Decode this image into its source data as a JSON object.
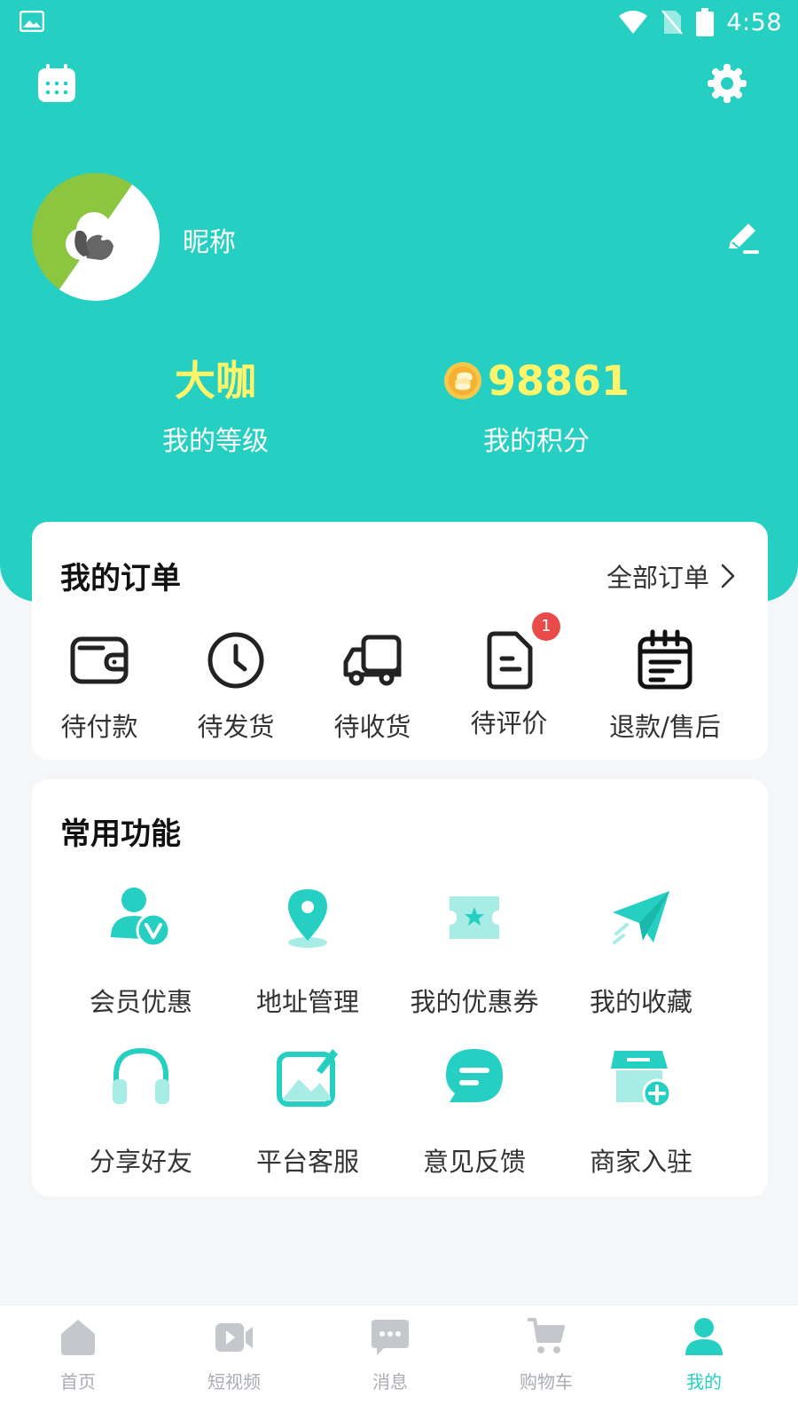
{
  "status_bar": {
    "time": "4:58"
  },
  "profile": {
    "nickname": "昵称"
  },
  "stats": {
    "level_value": "大咖",
    "level_label": "我的等级",
    "points_value": "98861",
    "points_label": "我的积分"
  },
  "orders": {
    "title": "我的订单",
    "all_label": "全部订单",
    "items": [
      {
        "label": "待付款",
        "icon": "wallet-icon"
      },
      {
        "label": "待发货",
        "icon": "clock-icon"
      },
      {
        "label": "待收货",
        "icon": "truck-icon"
      },
      {
        "label": "待评价",
        "icon": "document-icon",
        "badge": "1"
      },
      {
        "label": "退款/售后",
        "icon": "calendar-list-icon"
      }
    ]
  },
  "functions": {
    "title": "常用功能",
    "items": [
      {
        "label": "会员优惠",
        "icon": "vip-member-icon"
      },
      {
        "label": "地址管理",
        "icon": "location-pin-icon"
      },
      {
        "label": "我的优惠券",
        "icon": "coupon-icon"
      },
      {
        "label": "我的收藏",
        "icon": "paper-plane-icon"
      },
      {
        "label": "分享好友",
        "icon": "headphones-icon"
      },
      {
        "label": "平台客服",
        "icon": "picture-edit-icon"
      },
      {
        "label": "意见反馈",
        "icon": "chat-bubble-icon"
      },
      {
        "label": "商家入驻",
        "icon": "store-add-icon"
      }
    ]
  },
  "tabbar": {
    "items": [
      {
        "label": "首页",
        "icon": "home-icon",
        "active": false
      },
      {
        "label": "短视频",
        "icon": "video-icon",
        "active": false
      },
      {
        "label": "消息",
        "icon": "message-icon",
        "active": false
      },
      {
        "label": "购物车",
        "icon": "cart-icon",
        "active": false
      },
      {
        "label": "我的",
        "icon": "user-icon",
        "active": true
      }
    ]
  },
  "colors": {
    "primary": "#25d0c3",
    "accent_yellow": "#fff46a",
    "badge_red": "#e94b4b",
    "tab_inactive": "#a9adb3"
  }
}
